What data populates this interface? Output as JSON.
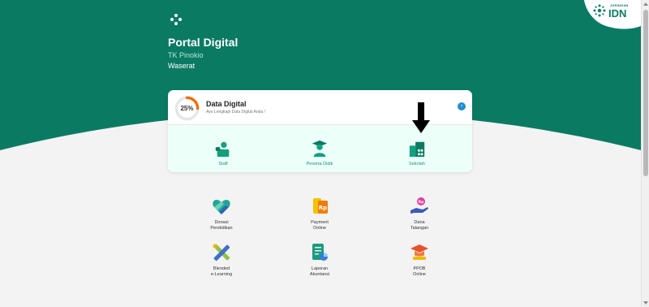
{
  "brand": {
    "small_text": "JARINGAN",
    "big_text": "IDN"
  },
  "header": {
    "title": "Portal Digital",
    "school_name": "TK Pinokio",
    "school_city": "Waserat"
  },
  "data_digital": {
    "progress_text": "25%",
    "progress_fraction": 0.25,
    "title": "Data Digital",
    "subtitle": "Ayo Lengkapi Data Digital Anda !"
  },
  "data_menu": [
    {
      "label": "Staff",
      "icon": "staff-icon"
    },
    {
      "label": "Peserta Didik",
      "icon": "graduate-icon"
    },
    {
      "label": "Sekolah",
      "icon": "building-icon"
    }
  ],
  "features": [
    {
      "label": "Donasi\nPendidikan",
      "icon": "heart-hands-icon"
    },
    {
      "label": "Payment\nOnline",
      "icon": "rupiah-icon"
    },
    {
      "label": "Dana\nTalangan",
      "icon": "coin-hand-icon"
    },
    {
      "label": "Blended\ne-Learning",
      "icon": "pencil-ruler-icon"
    },
    {
      "label": "Laporan\nAkuntansi",
      "icon": "report-icon"
    },
    {
      "label": "PPDB\nOnline",
      "icon": "grad-cap-icon"
    }
  ],
  "colors": {
    "brand_green": "#0a7a63",
    "accent_orange": "#ef6c00",
    "background": "#f3f3f3"
  }
}
